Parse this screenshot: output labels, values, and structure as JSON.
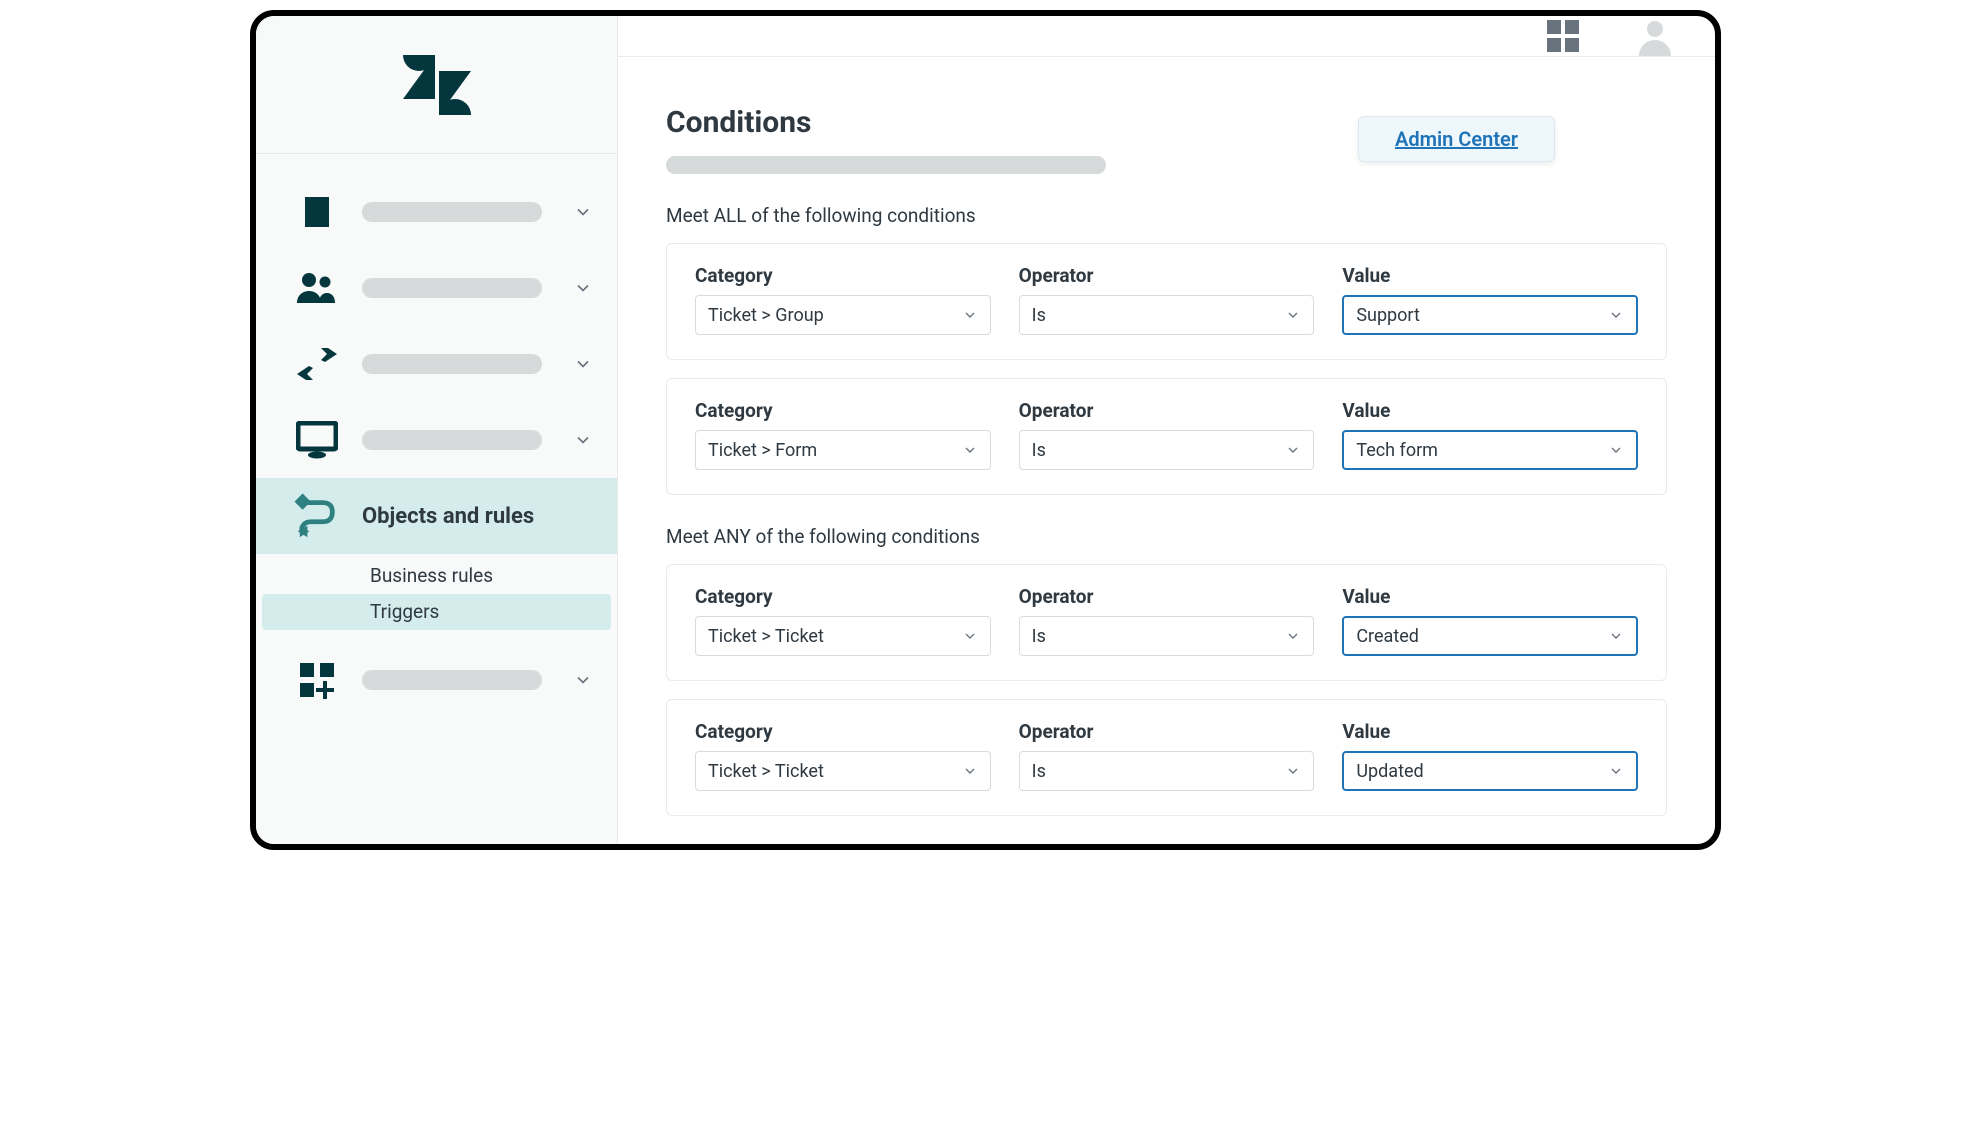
{
  "header": {
    "admin_center_label": "Admin Center"
  },
  "sidebar": {
    "active_item_label": "Objects and rules",
    "sub_items": [
      {
        "label": "Business rules"
      },
      {
        "label": "Triggers"
      }
    ]
  },
  "main": {
    "title": "Conditions",
    "section_all_label": "Meet ALL of the following conditions",
    "section_any_label": "Meet ANY of the following conditions",
    "columns": {
      "category": "Category",
      "operator": "Operator",
      "value": "Value"
    },
    "all_conditions": [
      {
        "category": "Ticket > Group",
        "operator": "Is",
        "value": "Support"
      },
      {
        "category": "Ticket > Form",
        "operator": "Is",
        "value": "Tech form"
      }
    ],
    "any_conditions": [
      {
        "category": "Ticket > Ticket",
        "operator": "Is",
        "value": "Created"
      },
      {
        "category": "Ticket > Ticket",
        "operator": "Is",
        "value": "Updated"
      }
    ]
  }
}
